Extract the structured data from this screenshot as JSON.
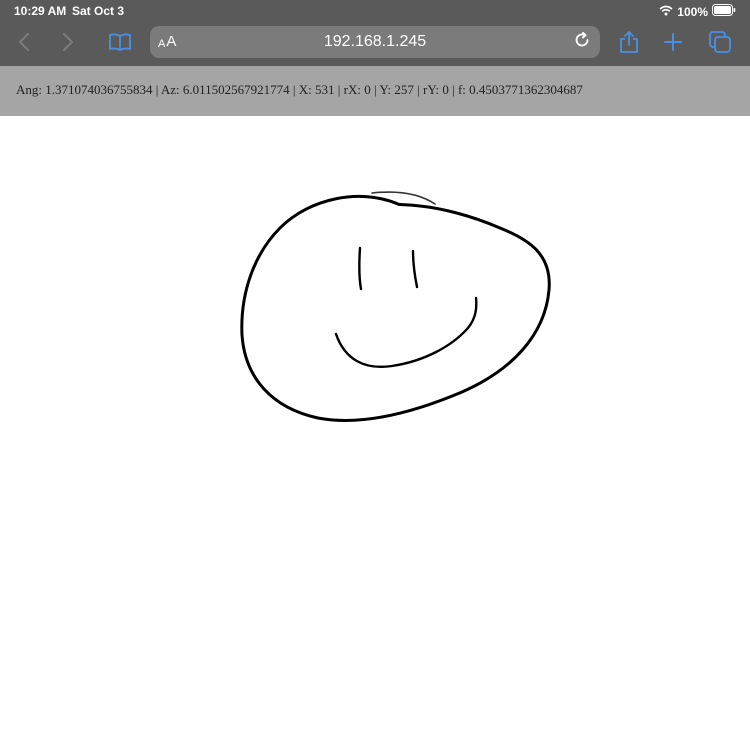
{
  "status_bar": {
    "time": "10:29 AM",
    "date": "Sat Oct 3",
    "battery_percent": "100%",
    "icons": [
      "wifi-icon",
      "battery-icon"
    ]
  },
  "toolbar": {
    "icons": [
      "back-icon",
      "forward-icon",
      "bookmarks-icon",
      "reload-icon",
      "share-icon",
      "new-tab-icon",
      "tabs-icon"
    ],
    "aa_small": "A",
    "aa_large": "A",
    "url": "192.168.1.245",
    "accent_color": "#4a90e2"
  },
  "info_bar": {
    "text": "Ang: 1.371074036755834 | Az: 6.011502567921774 | X: 531 | rX: 0 | Y: 257 | rY: 0 | f: 0.4503771362304687"
  },
  "colors": {
    "chrome": "#5a5a5a",
    "address_field": "#7b7b7b",
    "info_bar": "#a5a5a5",
    "ink": "#000000"
  }
}
